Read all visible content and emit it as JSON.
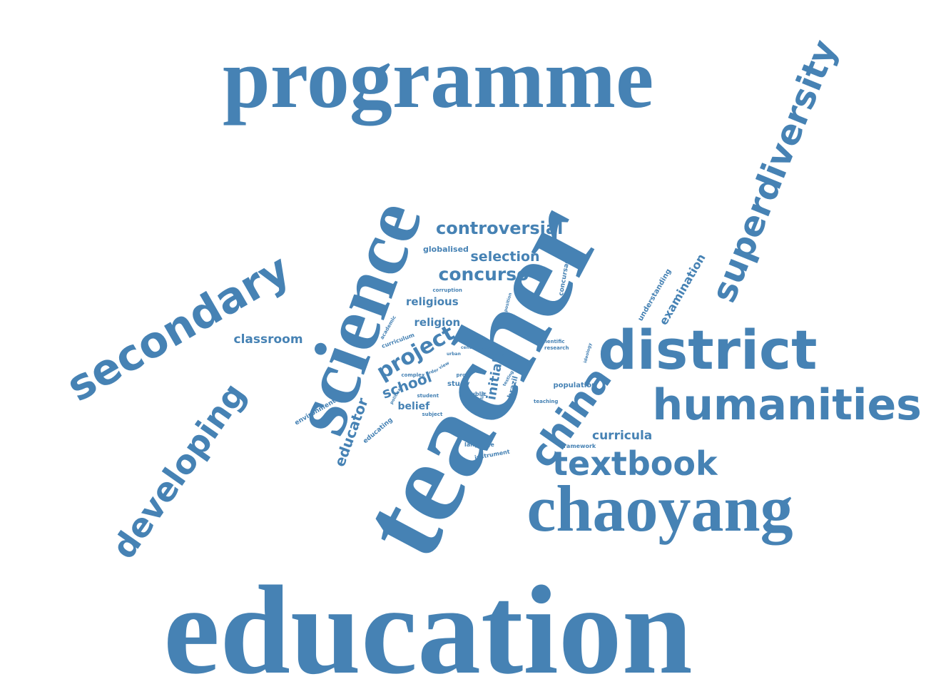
{
  "color": "#4682b4",
  "background": "#ffffff",
  "words": [
    {
      "id": "education",
      "text": "education"
    },
    {
      "id": "programme",
      "text": "programme"
    },
    {
      "id": "teacher",
      "text": "teacher"
    },
    {
      "id": "science",
      "text": "science"
    },
    {
      "id": "chaoyang",
      "text": "chaoyang"
    },
    {
      "id": "humanities",
      "text": "humanities"
    },
    {
      "id": "district",
      "text": "district"
    },
    {
      "id": "secondary",
      "text": "secondary"
    },
    {
      "id": "superdiversity",
      "text": "superdiversity"
    },
    {
      "id": "developing",
      "text": "developing"
    },
    {
      "id": "china",
      "text": "china"
    },
    {
      "id": "textbook",
      "text": "textbook"
    },
    {
      "id": "controversial",
      "text": "controversial"
    },
    {
      "id": "concurso",
      "text": "concurso"
    },
    {
      "id": "project",
      "text": "project"
    },
    {
      "id": "selection",
      "text": "selection"
    },
    {
      "id": "classroom",
      "text": "classroom"
    },
    {
      "id": "religious",
      "text": "religious"
    },
    {
      "id": "religion",
      "text": "religion"
    },
    {
      "id": "curricula",
      "text": "curricula"
    },
    {
      "id": "examination",
      "text": "examination"
    },
    {
      "id": "school",
      "text": "school"
    },
    {
      "id": "educator",
      "text": "educator"
    },
    {
      "id": "initial",
      "text": "initial"
    },
    {
      "id": "belief",
      "text": "belief"
    },
    {
      "id": "study",
      "text": "study"
    },
    {
      "id": "understanding",
      "text": "understanding"
    },
    {
      "id": "concursados",
      "text": "concursados"
    },
    {
      "id": "globalised",
      "text": "globalised"
    },
    {
      "id": "brazil",
      "text": "brazil"
    },
    {
      "id": "population",
      "text": "population"
    },
    {
      "id": "environment",
      "text": "environment"
    },
    {
      "id": "educating",
      "text": "educating"
    },
    {
      "id": "language",
      "text": "language"
    },
    {
      "id": "instrument",
      "text": "instrument"
    },
    {
      "id": "framework",
      "text": "framework"
    },
    {
      "id": "public",
      "text": "public"
    },
    {
      "id": "curriculum",
      "text": "curriculum"
    },
    {
      "id": "corruption",
      "text": "corruption"
    },
    {
      "id": "academic",
      "text": "academic"
    },
    {
      "id": "complex",
      "text": "complex"
    },
    {
      "id": "scientific",
      "text": "scientific"
    },
    {
      "id": "research",
      "text": "research"
    },
    {
      "id": "proc",
      "text": "proc"
    },
    {
      "id": "issue",
      "text": "issue"
    },
    {
      "id": "student",
      "text": "student"
    },
    {
      "id": "subject",
      "text": "subject"
    },
    {
      "id": "teaching",
      "text": "teaching"
    },
    {
      "id": "quality",
      "text": "quality"
    },
    {
      "id": "ideology",
      "text": "ideology"
    },
    {
      "id": "position",
      "text": "position"
    },
    {
      "id": "political",
      "text": "political"
    },
    {
      "id": "centre",
      "text": "centre"
    },
    {
      "id": "paper",
      "text": "paper"
    },
    {
      "id": "urban",
      "text": "urban"
    },
    {
      "id": "order",
      "text": "order"
    },
    {
      "id": "view",
      "text": "view"
    },
    {
      "id": "testing",
      "text": "testing"
    }
  ]
}
